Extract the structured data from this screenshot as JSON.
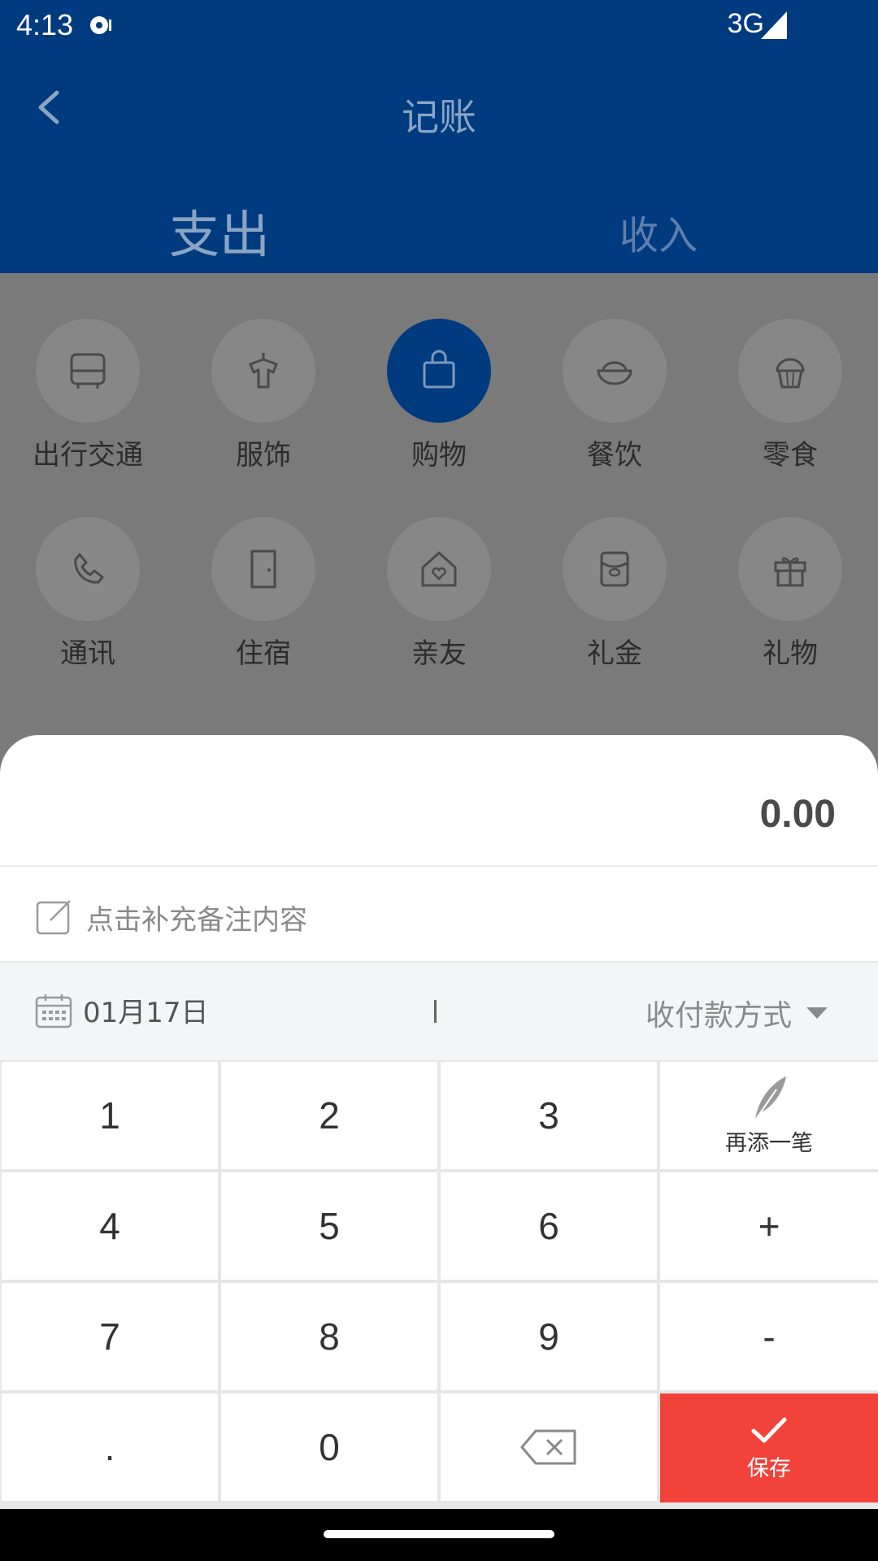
{
  "status": {
    "time": "4:13",
    "network": "3G"
  },
  "header": {
    "title": "记账",
    "tab_expense": "支出",
    "tab_income": "收入"
  },
  "categories": [
    {
      "label": "出行交通",
      "icon": "bus-icon",
      "selected": false
    },
    {
      "label": "服饰",
      "icon": "shirt-icon",
      "selected": false
    },
    {
      "label": "购物",
      "icon": "shopping-bag-icon",
      "selected": true
    },
    {
      "label": "餐饮",
      "icon": "rice-bowl-icon",
      "selected": false
    },
    {
      "label": "零食",
      "icon": "cupcake-icon",
      "selected": false
    },
    {
      "label": "通讯",
      "icon": "phone-icon",
      "selected": false
    },
    {
      "label": "住宿",
      "icon": "door-icon",
      "selected": false
    },
    {
      "label": "亲友",
      "icon": "house-heart-icon",
      "selected": false
    },
    {
      "label": "礼金",
      "icon": "red-envelope-icon",
      "selected": false
    },
    {
      "label": "礼物",
      "icon": "gift-icon",
      "selected": false
    }
  ],
  "entry": {
    "amount": "0.00",
    "note_placeholder": "点击补充备注内容",
    "date": "01月17日",
    "payment_method": "收付款方式"
  },
  "keypad": {
    "keys": [
      "1",
      "2",
      "3",
      "4",
      "5",
      "6",
      "+",
      "7",
      "8",
      "9",
      "-",
      ".",
      "0"
    ],
    "add_another_label": "再添一笔",
    "save_label": "保存"
  },
  "colors": {
    "primary": "#003a7f",
    "save": "#f2433b",
    "overlay": "#7a7a7a"
  }
}
